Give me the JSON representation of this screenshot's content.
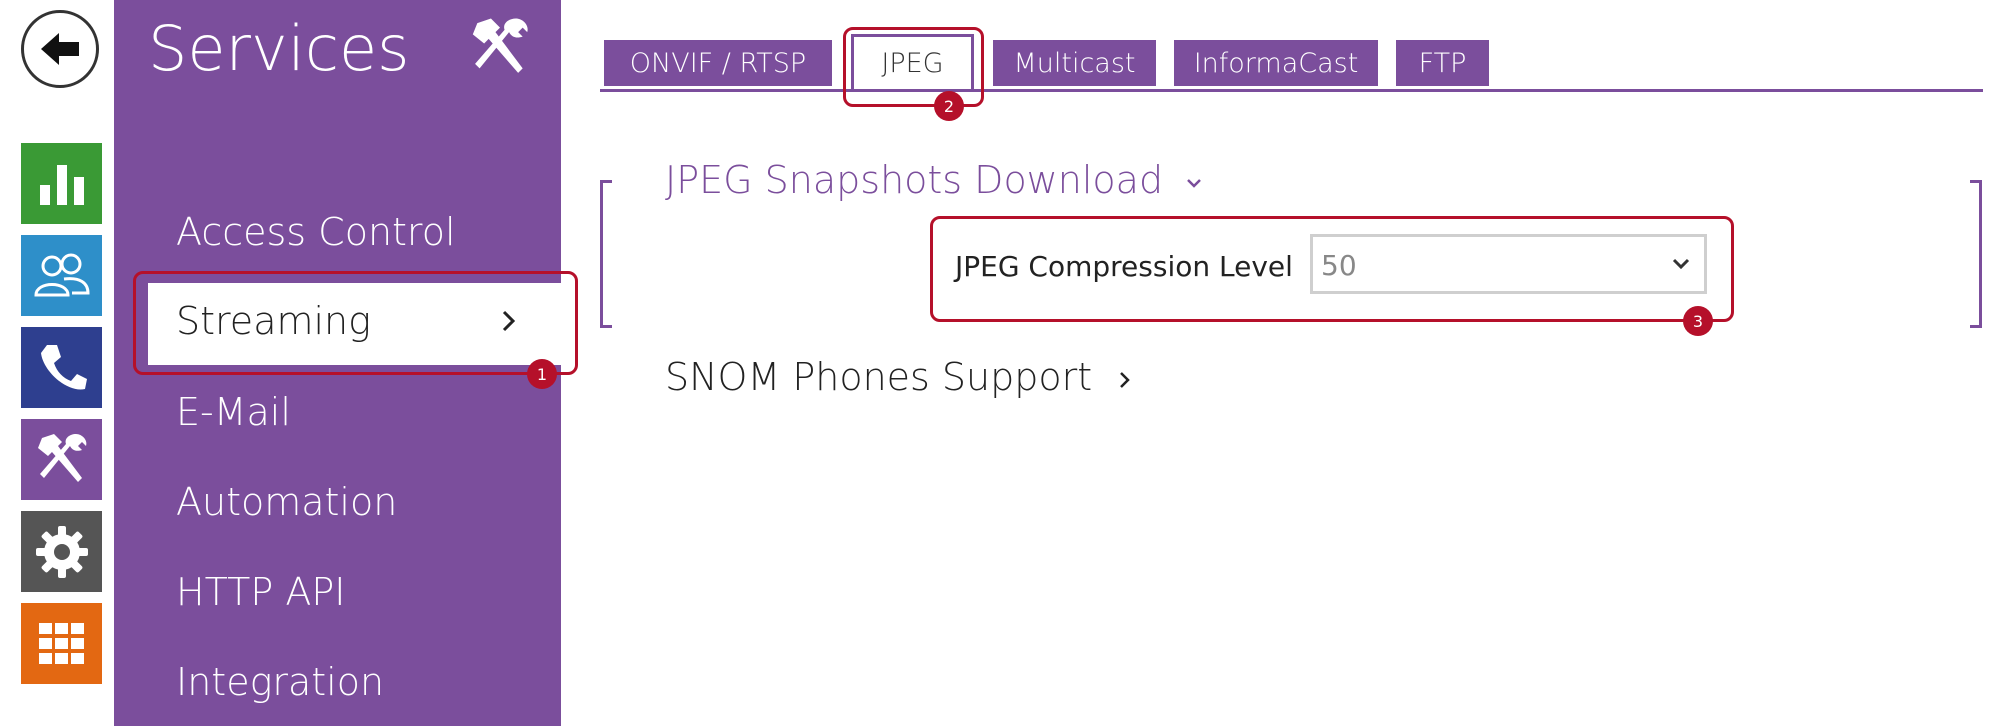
{
  "colors": {
    "brand_purple": "#7b4e9c",
    "highlight_red": "#b5102a",
    "status_green": "#3a9a35",
    "users_blue": "#2e8fc9",
    "phone_navy": "#2e3f8f",
    "settings_gray": "#555555",
    "apps_orange": "#e36812"
  },
  "rail": {
    "back_icon": "back-arrow-icon",
    "items": [
      {
        "icon": "status-chart-icon"
      },
      {
        "icon": "directory-users-icon"
      },
      {
        "icon": "phone-icon"
      },
      {
        "icon": "services-tools-icon"
      },
      {
        "icon": "settings-gear-icon"
      },
      {
        "icon": "apps-grid-icon"
      }
    ]
  },
  "services": {
    "title": "Services",
    "menu": [
      "Access Control",
      "Streaming",
      "E-Mail",
      "Automation",
      "HTTP API",
      "Integration"
    ],
    "active": "Streaming"
  },
  "tabs": [
    "ONVIF / RTSP",
    "JPEG",
    "Multicast",
    "InformaCast",
    "FTP"
  ],
  "active_tab": "JPEG",
  "badges": [
    "1",
    "2",
    "3"
  ],
  "content": {
    "section1": "JPEG Snapshots Download",
    "compression_label": "JPEG Compression Level",
    "compression_value": "50",
    "section2": "SNOM Phones Support"
  }
}
